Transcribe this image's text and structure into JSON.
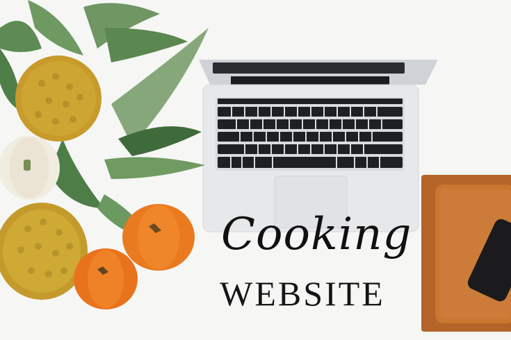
{
  "scene": {
    "description_title": "Cooking",
    "subtitle": "WEBSITE"
  },
  "colors": {
    "background": "#f6f6f5",
    "laptop_silver": "#e6e7e8",
    "keyboard": "#1f2022",
    "pumpkin": "#ea7a1f",
    "pineapple": "#c9a02c",
    "leaf": "#6c8f5a",
    "board": "#b7692c"
  }
}
